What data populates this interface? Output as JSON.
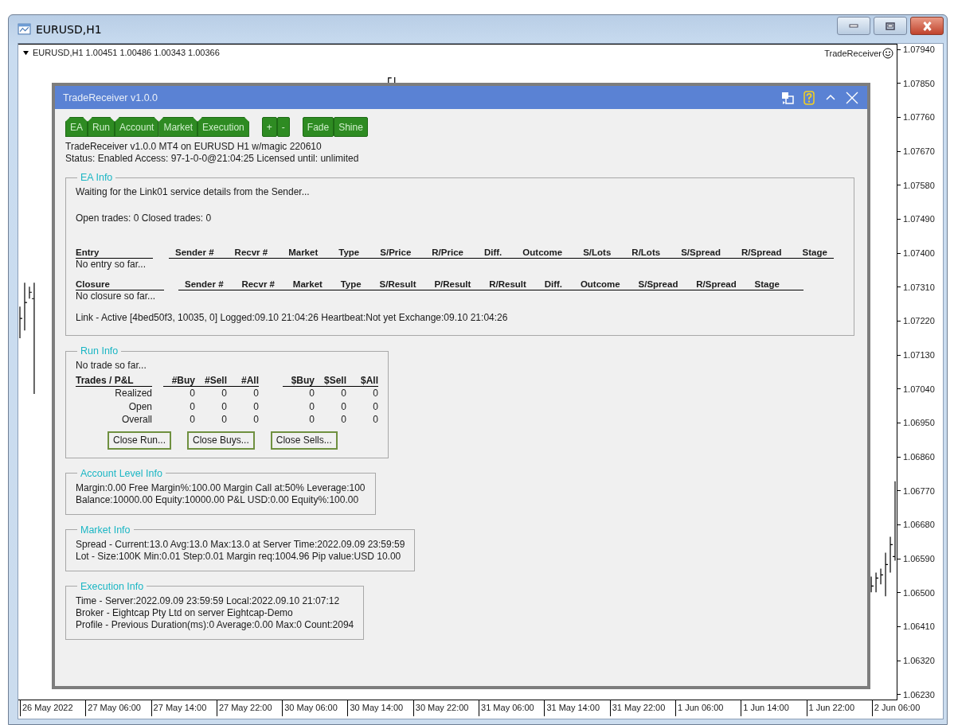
{
  "window": {
    "title": "EURUSD,H1"
  },
  "chart": {
    "header": "EURUSD,H1  1.00451 1.00486 1.00343 1.00366",
    "indicator": "TradeReceiver",
    "price_axis": [
      "1.07940",
      "1.07850",
      "1.07760",
      "1.07670",
      "1.07580",
      "1.07490",
      "1.07400",
      "1.07310",
      "1.07220",
      "1.07130",
      "1.07040",
      "1.06950",
      "1.06860",
      "1.06770",
      "1.06680",
      "1.06590",
      "1.06500",
      "1.06410",
      "1.06320",
      "1.06230"
    ],
    "time_axis": [
      "26 May 2022",
      "27 May 06:00",
      "27 May 14:00",
      "27 May 22:00",
      "30 May 06:00",
      "30 May 14:00",
      "30 May 22:00",
      "31 May 06:00",
      "31 May 14:00",
      "31 May 22:00",
      "1 Jun 06:00",
      "1 Jun 14:00",
      "1 Jun 22:00",
      "2 Jun 06:00"
    ]
  },
  "panel": {
    "title": "TradeReceiver v1.0.0",
    "toolbar_groups": [
      {
        "kind": "tab",
        "buttons": [
          "EA",
          "Run",
          "Account",
          "Market",
          "Execution"
        ]
      },
      {
        "kind": "square",
        "buttons": [
          "+",
          "-"
        ]
      },
      {
        "kind": "square",
        "buttons": [
          "Fade",
          "Shine"
        ]
      }
    ],
    "info_lines": [
      "TradeReceiver v1.0.0 MT4 on EURUSD H1 w/magic 220610",
      "Status: Enabled Access: 97-1-0-0@21:04:25 Licensed until: unlimited"
    ],
    "ea_info": {
      "title": "EA Info",
      "lines": [
        "Waiting for the Link01 service details from the Sender...",
        "Open trades: 0 Closed trades: 0"
      ],
      "tables": [
        {
          "heading": "Entry",
          "columns": [
            "Sender #",
            "Recvr #",
            "Market",
            "Type",
            "S/Price",
            "R/Price",
            "Diff.",
            "Outcome",
            "S/Lots",
            "R/Lots",
            "S/Spread",
            "R/Spread",
            "Stage"
          ],
          "empty_text": "No entry so far..."
        },
        {
          "heading": "Closure",
          "columns": [
            "Sender #",
            "Recvr #",
            "Market",
            "Type",
            "S/Result",
            "P/Result",
            "R/Result",
            "Diff.",
            "Outcome",
            "S/Spread",
            "R/Spread",
            "Stage"
          ],
          "empty_text": "No closure so far..."
        }
      ],
      "link_line": "Link - Active [4bed50f3, 10035, 0]  Logged:09.10 21:04:26 Heartbeat:Not yet Exchange:09.10 21:04:26"
    },
    "run_info": {
      "title": "Run Info",
      "message": "No trade so far...",
      "table": {
        "heading": "Trades / P&L",
        "count_columns": [
          "#Buy",
          "#Sell",
          "#All"
        ],
        "amount_columns": [
          "$Buy",
          "$Sell",
          "$All"
        ],
        "rows": [
          {
            "label": "Realized",
            "counts": [
              "0",
              "0",
              "0"
            ],
            "amounts": [
              "0",
              "0",
              "0"
            ]
          },
          {
            "label": "Open",
            "counts": [
              "0",
              "0",
              "0"
            ],
            "amounts": [
              "0",
              "0",
              "0"
            ]
          },
          {
            "label": "Overall",
            "counts": [
              "0",
              "0",
              "0"
            ],
            "amounts": [
              "0",
              "0",
              "0"
            ]
          }
        ]
      },
      "buttons": [
        "Close Run...",
        "Close Buys...",
        "Close Sells..."
      ]
    },
    "account_info": {
      "title": "Account Level Info",
      "lines": [
        "Margin:0.00 Free Margin%:100.00 Margin Call at:50% Leverage:100",
        "Balance:10000.00 Equity:10000.00 P&L USD:0.00 Equity%:100.00"
      ]
    },
    "market_info": {
      "title": "Market Info",
      "lines": [
        "Spread - Current:13.0 Avg:13.0 Max:13.0 at Server Time:2022.09.09 23:59:59",
        "Lot - Size:100K Min:0.01 Step:0.01 Margin req:1004.96 Pip value:USD 10.00"
      ]
    },
    "execution_info": {
      "title": "Execution Info",
      "lines": [
        "Time - Server:2022.09.09 23:59:59 Local:2022.09.10 21:07:12",
        "Broker - Eightcap Pty Ltd on server Eightcap-Demo",
        "Profile - Previous Duration(ms):0 Average:0.00 Max:0 Count:2094"
      ]
    }
  }
}
